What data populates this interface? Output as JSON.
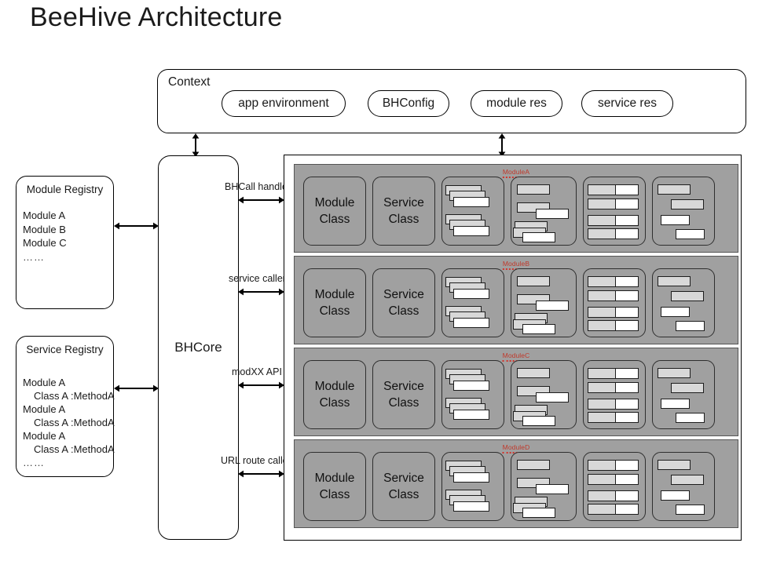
{
  "page": {
    "title": "BeeHive Architecture"
  },
  "context": {
    "title": "Context",
    "pills": [
      {
        "label": "app environment"
      },
      {
        "label": "BHConfig"
      },
      {
        "label": "module res"
      },
      {
        "label": "service res"
      }
    ]
  },
  "registries": [
    {
      "id": "module-registry",
      "title": "Module Registry",
      "lines": [
        {
          "text": "Module A",
          "indent": false
        },
        {
          "text": "Module B",
          "indent": false
        },
        {
          "text": "Module C",
          "indent": false
        },
        {
          "text": "……",
          "indent": false,
          "dots": true
        }
      ]
    },
    {
      "id": "service-registry",
      "title": "Service Registry",
      "lines": [
        {
          "text": "Module A",
          "indent": false
        },
        {
          "text": "Class A :MethodA",
          "indent": true
        },
        {
          "text": "Module A",
          "indent": false
        },
        {
          "text": "Class A :MethodA",
          "indent": true
        },
        {
          "text": "Module A",
          "indent": false
        },
        {
          "text": "Class A :MethodA",
          "indent": true
        },
        {
          "text": "……",
          "indent": false,
          "dots": true
        }
      ]
    }
  ],
  "core": {
    "label": "BHCore"
  },
  "connectors": [
    {
      "label": "BHCall handle"
    },
    {
      "label": "service caller"
    },
    {
      "label": "modXX API"
    },
    {
      "label": "URL route caller"
    }
  ],
  "modules": [
    {
      "label": "ModuleA",
      "cards": [
        {
          "type": "text",
          "lines": [
            "Module",
            "Class"
          ]
        },
        {
          "type": "text",
          "lines": [
            "Service",
            "Class"
          ]
        },
        {
          "type": "stack-pairs"
        },
        {
          "type": "cascade"
        },
        {
          "type": "grid"
        },
        {
          "type": "stagger"
        }
      ]
    },
    {
      "label": "ModuleB",
      "cards": [
        {
          "type": "text",
          "lines": [
            "Module",
            "Class"
          ]
        },
        {
          "type": "text",
          "lines": [
            "Service",
            "Class"
          ]
        },
        {
          "type": "stack-pairs"
        },
        {
          "type": "cascade"
        },
        {
          "type": "grid"
        },
        {
          "type": "stagger"
        }
      ]
    },
    {
      "label": "ModuleC",
      "cards": [
        {
          "type": "text",
          "lines": [
            "Module",
            "Class"
          ]
        },
        {
          "type": "text",
          "lines": [
            "Service",
            "Class"
          ]
        },
        {
          "type": "stack-pairs"
        },
        {
          "type": "cascade"
        },
        {
          "type": "grid"
        },
        {
          "type": "stagger"
        }
      ]
    },
    {
      "label": "ModuleD",
      "cards": [
        {
          "type": "text",
          "lines": [
            "Module",
            "Class"
          ]
        },
        {
          "type": "text",
          "lines": [
            "Service",
            "Class"
          ]
        },
        {
          "type": "stack-pairs"
        },
        {
          "type": "cascade"
        },
        {
          "type": "grid"
        },
        {
          "type": "stagger"
        }
      ]
    }
  ],
  "colors": {
    "module_row_gray": "#a0a0a0",
    "bar_light": "#d8d8d8",
    "bar_white": "#ffffff",
    "label_red": "#c0392b",
    "outline": "#000000"
  }
}
